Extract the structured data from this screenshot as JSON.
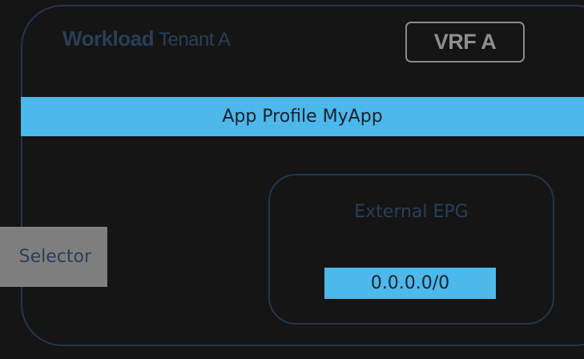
{
  "tenant": {
    "label_bold": "Workload",
    "label_rest": "Tenant A"
  },
  "vrf": {
    "label": "VRF A"
  },
  "app_profile": {
    "label": "App Profile MyApp"
  },
  "external_epg": {
    "title": "External EPG",
    "subnet": "0.0.0.0/0"
  },
  "selector": {
    "label": "Selector"
  }
}
